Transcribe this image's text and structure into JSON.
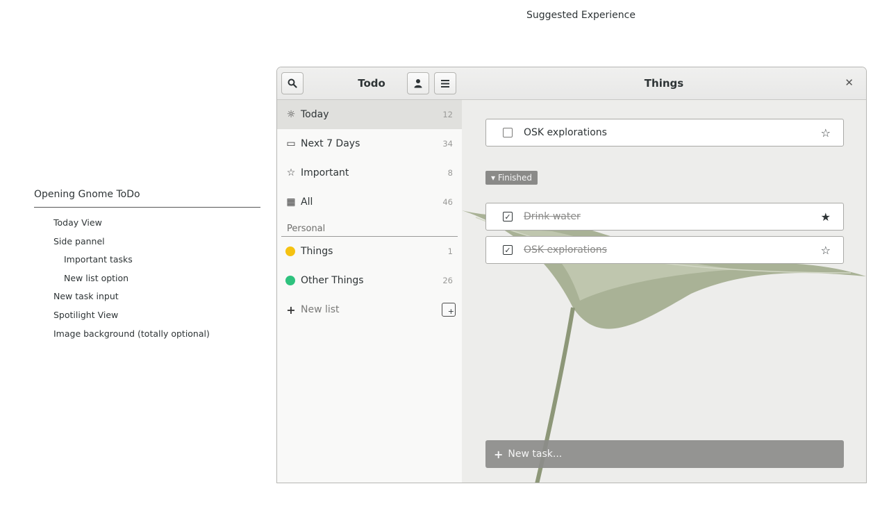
{
  "page": {
    "caption": "Suggested Experience"
  },
  "outline": {
    "title": "Opening Gnome ToDo",
    "items": [
      {
        "label": "Today View",
        "level": 1
      },
      {
        "label": "Side pannel",
        "level": 1
      },
      {
        "label": "Important tasks",
        "level": 2
      },
      {
        "label": "New list option",
        "level": 2
      },
      {
        "label": "New task input",
        "level": 1
      },
      {
        "label": "Spotilight View",
        "level": 1
      },
      {
        "label": "Image background (totally optional)",
        "level": 1
      }
    ]
  },
  "sidebar": {
    "title": "Todo",
    "icons": {
      "search": "search-icon",
      "user": "user-icon",
      "menu": "hamburger-menu-icon"
    },
    "items": [
      {
        "label": "Today",
        "count": "12",
        "icon": "sun-icon",
        "glyph": "☼",
        "active": true
      },
      {
        "label": "Next 7 Days",
        "count": "34",
        "icon": "calendar-icon",
        "glyph": "▭"
      },
      {
        "label": "Important",
        "count": "8",
        "icon": "star-outline-icon",
        "glyph": "☆"
      },
      {
        "label": "All",
        "count": "46",
        "icon": "grid-icon",
        "glyph": "▦"
      }
    ],
    "section_label": "Personal",
    "lists": [
      {
        "label": "Things",
        "count": "1",
        "color": "#f5c211"
      },
      {
        "label": "Other Things",
        "count": "26",
        "color": "#2ec27e"
      }
    ],
    "new_list": {
      "label": "New list",
      "icon": "plus-icon"
    }
  },
  "main": {
    "title": "Things",
    "icons": {
      "tip": "lightbulb-icon",
      "more": "kebab-menu-icon",
      "close": "close-icon"
    },
    "tasks": [
      {
        "title": "OSK explorations",
        "done": false,
        "starred": false
      }
    ],
    "finished_label": "Finished",
    "finished_tasks": [
      {
        "title": "Drink water",
        "done": true,
        "starred": true
      },
      {
        "title": "OSK explorations",
        "done": true,
        "starred": false
      }
    ],
    "new_task_placeholder": "New task..."
  },
  "colors": {
    "accent_yellow": "#f5c211",
    "accent_green": "#2ec27e",
    "new_task_bg": "#8c8c8a",
    "chip_bg": "#8a8a88"
  }
}
